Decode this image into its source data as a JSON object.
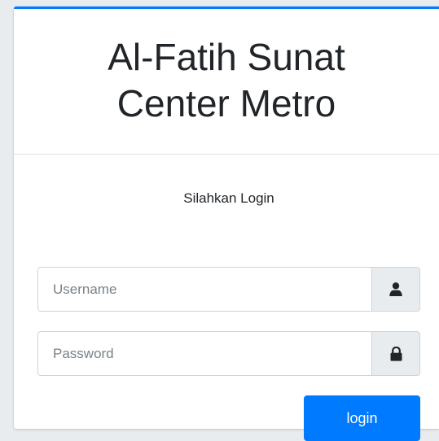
{
  "brand": {
    "line1": "Al-Fatih Sunat",
    "line2": "Center Metro"
  },
  "login": {
    "message": "Silahkan Login",
    "username_placeholder": "Username",
    "password_placeholder": "Password",
    "username_icon": "user-icon",
    "password_icon": "lock-icon",
    "submit_label": "login"
  },
  "colors": {
    "accent": "#007bff",
    "addon_bg": "#e9ecef",
    "border": "#ced4da",
    "text": "#212529"
  }
}
